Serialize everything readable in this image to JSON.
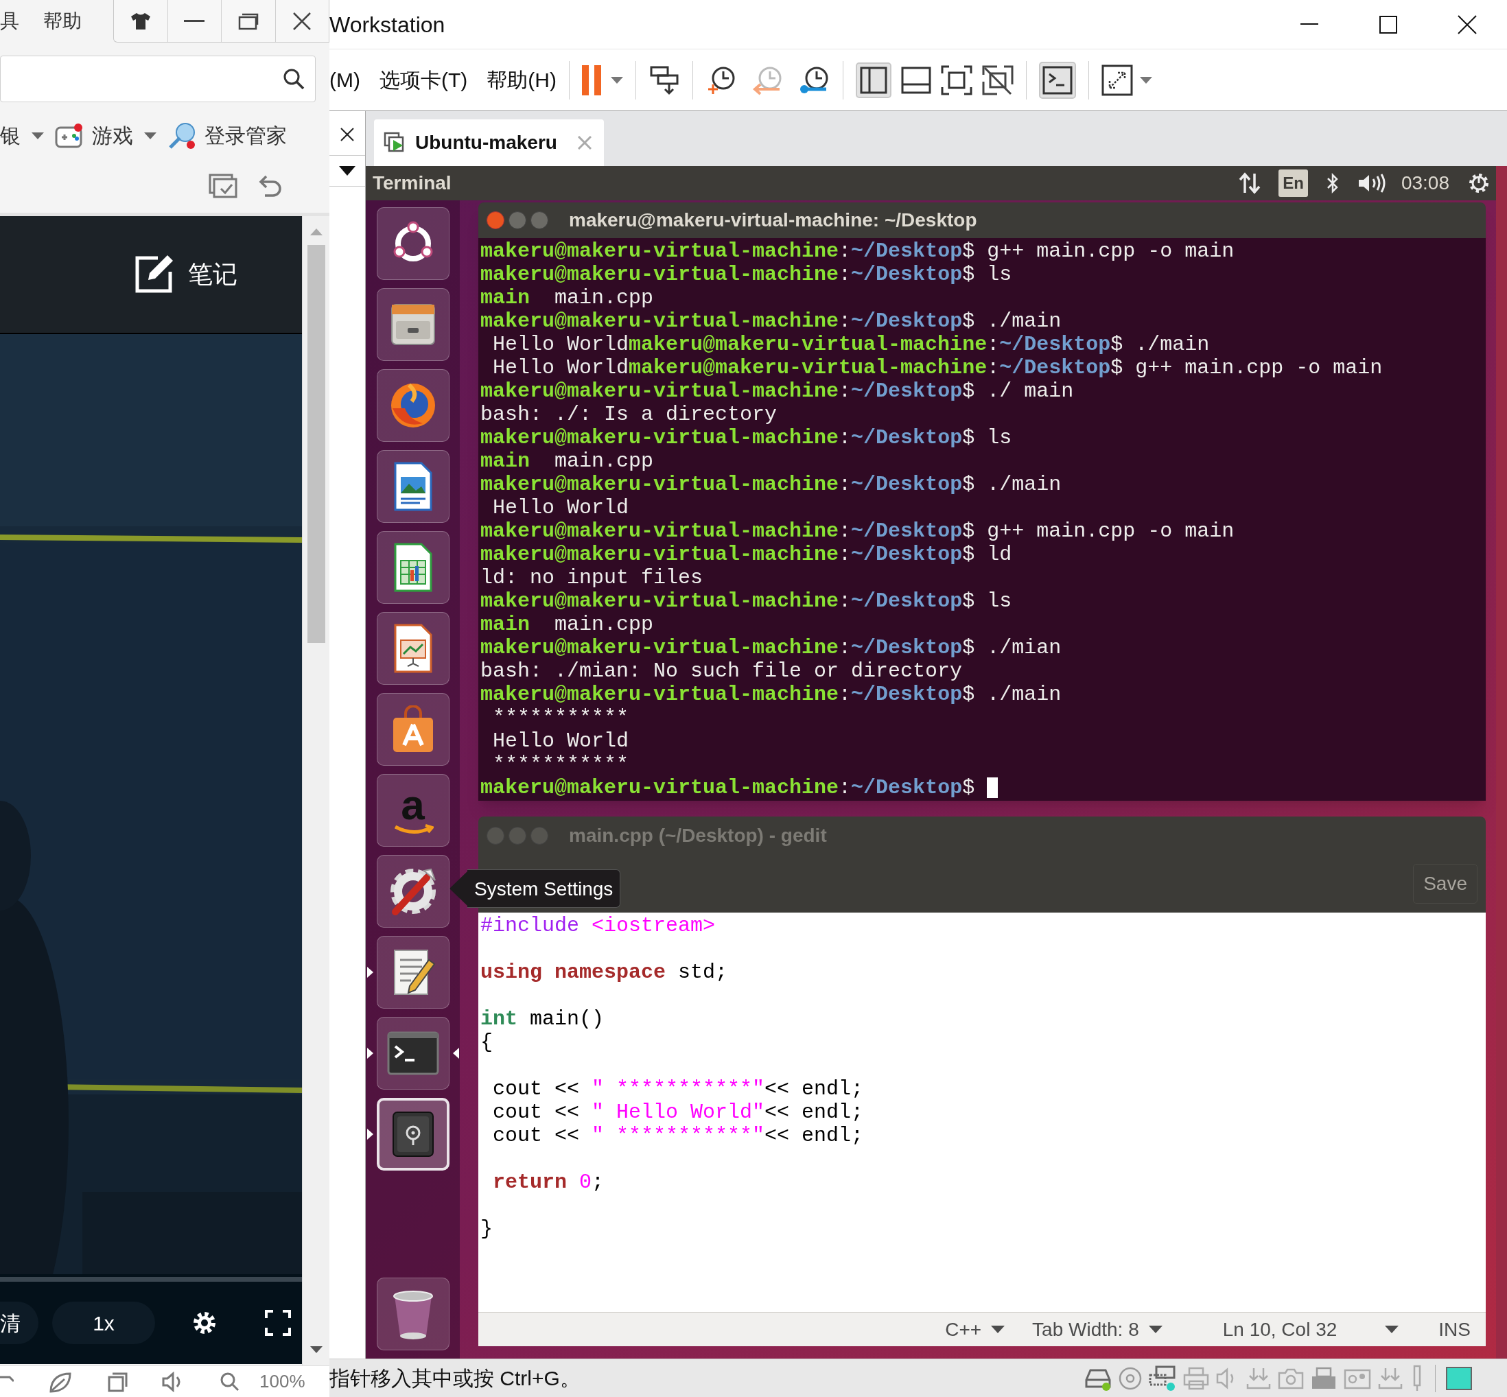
{
  "browser": {
    "menu": [
      "具",
      "帮助"
    ],
    "bookmarks": [
      {
        "label": "银",
        "kind": "bank",
        "dropdown": true
      },
      {
        "label": "游戏",
        "kind": "games",
        "dropdown": true
      },
      {
        "label": "登录管家",
        "kind": "key",
        "dropdown": false
      }
    ],
    "notes": "笔记",
    "player": {
      "quality": "清",
      "speed": "1x"
    },
    "zoom": "100%"
  },
  "vmware": {
    "title": "Workstation",
    "menu": [
      "(M)",
      "选项卡(T)",
      "帮助(H)"
    ],
    "tabs": [
      {
        "label": "Ubuntu-makeru",
        "selected": true
      }
    ],
    "hint": "指针移入其中或按 Ctrl+G。"
  },
  "ubuntu": {
    "panel": {
      "app": "Terminal",
      "keyboard": "En",
      "time": "03:08"
    },
    "launcher": [
      {
        "kind": "dash",
        "running": false,
        "focused": false,
        "selected": false
      },
      {
        "kind": "files",
        "running": false,
        "focused": false,
        "selected": false
      },
      {
        "kind": "firefox",
        "running": false,
        "focused": false,
        "selected": false
      },
      {
        "kind": "writer",
        "running": false,
        "focused": false,
        "selected": false
      },
      {
        "kind": "calc",
        "running": false,
        "focused": false,
        "selected": false
      },
      {
        "kind": "impress",
        "running": false,
        "focused": false,
        "selected": false
      },
      {
        "kind": "software",
        "running": false,
        "focused": false,
        "selected": false
      },
      {
        "kind": "amazon",
        "glyph": "a",
        "running": false,
        "focused": false,
        "selected": false
      },
      {
        "kind": "settings",
        "running": false,
        "focused": false,
        "selected": false
      },
      {
        "kind": "gedit",
        "running": true,
        "focused": false,
        "selected": false
      },
      {
        "kind": "terminal",
        "running": true,
        "focused": true,
        "selected": false
      },
      {
        "kind": "safe",
        "running": true,
        "focused": false,
        "selected": true
      },
      {
        "kind": "trash",
        "running": false,
        "focused": false,
        "selected": false
      }
    ],
    "terminal": {
      "title": "makeru@makeru-virtual-machine: ~/Desktop",
      "cursor": true,
      "lines": [
        [
          {
            "kind": "user",
            "text": "makeru@makeru-virtual-machine"
          },
          {
            "kind": "text",
            "text": ":"
          },
          {
            "kind": "path",
            "text": "~/Desktop"
          },
          {
            "kind": "text",
            "text": "$ g++ main.cpp -o main"
          }
        ],
        [
          {
            "kind": "user",
            "text": "makeru@makeru-virtual-machine"
          },
          {
            "kind": "text",
            "text": ":"
          },
          {
            "kind": "path",
            "text": "~/Desktop"
          },
          {
            "kind": "text",
            "text": "$ ls"
          }
        ],
        [
          {
            "kind": "exec",
            "text": "main"
          },
          {
            "kind": "text",
            "text": "  main.cpp"
          }
        ],
        [
          {
            "kind": "user",
            "text": "makeru@makeru-virtual-machine"
          },
          {
            "kind": "text",
            "text": ":"
          },
          {
            "kind": "path",
            "text": "~/Desktop"
          },
          {
            "kind": "text",
            "text": "$ ./main"
          }
        ],
        [
          {
            "kind": "text",
            "text": " Hello World"
          },
          {
            "kind": "user",
            "text": "makeru@makeru-virtual-machine"
          },
          {
            "kind": "text",
            "text": ":"
          },
          {
            "kind": "path",
            "text": "~/Desktop"
          },
          {
            "kind": "text",
            "text": "$ ./main"
          }
        ],
        [
          {
            "kind": "text",
            "text": " Hello World"
          },
          {
            "kind": "user",
            "text": "makeru@makeru-virtual-machine"
          },
          {
            "kind": "text",
            "text": ":"
          },
          {
            "kind": "path",
            "text": "~/Desktop"
          },
          {
            "kind": "text",
            "text": "$ g++ main.cpp -o main"
          }
        ],
        [
          {
            "kind": "user",
            "text": "makeru@makeru-virtual-machine"
          },
          {
            "kind": "text",
            "text": ":"
          },
          {
            "kind": "path",
            "text": "~/Desktop"
          },
          {
            "kind": "text",
            "text": "$ ./ main"
          }
        ],
        [
          {
            "kind": "text",
            "text": "bash: ./: Is a directory"
          }
        ],
        [
          {
            "kind": "user",
            "text": "makeru@makeru-virtual-machine"
          },
          {
            "kind": "text",
            "text": ":"
          },
          {
            "kind": "path",
            "text": "~/Desktop"
          },
          {
            "kind": "text",
            "text": "$ ls"
          }
        ],
        [
          {
            "kind": "exec",
            "text": "main"
          },
          {
            "kind": "text",
            "text": "  main.cpp"
          }
        ],
        [
          {
            "kind": "user",
            "text": "makeru@makeru-virtual-machine"
          },
          {
            "kind": "text",
            "text": ":"
          },
          {
            "kind": "path",
            "text": "~/Desktop"
          },
          {
            "kind": "text",
            "text": "$ ./main"
          }
        ],
        [
          {
            "kind": "text",
            "text": " Hello World"
          }
        ],
        [
          {
            "kind": "user",
            "text": "makeru@makeru-virtual-machine"
          },
          {
            "kind": "text",
            "text": ":"
          },
          {
            "kind": "path",
            "text": "~/Desktop"
          },
          {
            "kind": "text",
            "text": "$ g++ main.cpp -o main"
          }
        ],
        [
          {
            "kind": "user",
            "text": "makeru@makeru-virtual-machine"
          },
          {
            "kind": "text",
            "text": ":"
          },
          {
            "kind": "path",
            "text": "~/Desktop"
          },
          {
            "kind": "text",
            "text": "$ ld"
          }
        ],
        [
          {
            "kind": "text",
            "text": "ld: no input files"
          }
        ],
        [
          {
            "kind": "user",
            "text": "makeru@makeru-virtual-machine"
          },
          {
            "kind": "text",
            "text": ":"
          },
          {
            "kind": "path",
            "text": "~/Desktop"
          },
          {
            "kind": "text",
            "text": "$ ls"
          }
        ],
        [
          {
            "kind": "exec",
            "text": "main"
          },
          {
            "kind": "text",
            "text": "  main.cpp"
          }
        ],
        [
          {
            "kind": "user",
            "text": "makeru@makeru-virtual-machine"
          },
          {
            "kind": "text",
            "text": ":"
          },
          {
            "kind": "path",
            "text": "~/Desktop"
          },
          {
            "kind": "text",
            "text": "$ ./mian"
          }
        ],
        [
          {
            "kind": "text",
            "text": "bash: ./mian: No such file or directory"
          }
        ],
        [
          {
            "kind": "user",
            "text": "makeru@makeru-virtual-machine"
          },
          {
            "kind": "text",
            "text": ":"
          },
          {
            "kind": "path",
            "text": "~/Desktop"
          },
          {
            "kind": "text",
            "text": "$ ./main"
          }
        ],
        [
          {
            "kind": "text",
            "text": " ***********"
          }
        ],
        [
          {
            "kind": "text",
            "text": " Hello World"
          }
        ],
        [
          {
            "kind": "text",
            "text": " ***********"
          }
        ],
        [
          {
            "kind": "user",
            "text": "makeru@makeru-virtual-machine"
          },
          {
            "kind": "text",
            "text": ":"
          },
          {
            "kind": "path",
            "text": "~/Desktop"
          },
          {
            "kind": "text",
            "text": "$"
          }
        ]
      ]
    },
    "gedit": {
      "title": "main.cpp (~/Desktop) - gedit",
      "active": false,
      "save": "Save",
      "tooltip": "System Settings",
      "lines": [
        {
          "segs": [
            {
              "kind": "preproc",
              "text": "#include "
            },
            {
              "kind": "string",
              "text": "<iostream>"
            }
          ]
        },
        {
          "kind": "blank"
        },
        {
          "segs": [
            {
              "kind": "keyword",
              "text": "using namespace"
            },
            {
              "kind": "text",
              "text": " std;"
            }
          ]
        },
        {
          "kind": "blank"
        },
        {
          "segs": [
            {
              "kind": "type",
              "text": "int"
            },
            {
              "kind": "text",
              "text": " main()"
            }
          ]
        },
        {
          "segs": [
            {
              "kind": "text",
              "text": "{"
            }
          ]
        },
        {
          "kind": "blank"
        },
        {
          "segs": [
            {
              "kind": "text",
              "text": " cout << "
            },
            {
              "kind": "string",
              "text": "\" ***********\""
            },
            {
              "kind": "text",
              "text": "<< endl;"
            }
          ]
        },
        {
          "segs": [
            {
              "kind": "text",
              "text": " cout << "
            },
            {
              "kind": "string",
              "text": "\" Hello World\""
            },
            {
              "kind": "text",
              "text": "<< endl;"
            }
          ]
        },
        {
          "segs": [
            {
              "kind": "text",
              "text": " cout << "
            },
            {
              "kind": "string",
              "text": "\" ***********\""
            },
            {
              "kind": "text",
              "text": "<< endl;"
            }
          ]
        },
        {
          "kind": "blank"
        },
        {
          "segs": [
            {
              "kind": "keyword",
              "text": " return "
            },
            {
              "kind": "number",
              "text": "0"
            },
            {
              "kind": "text",
              "text": ";"
            }
          ]
        },
        {
          "kind": "blank"
        },
        {
          "segs": [
            {
              "kind": "text",
              "text": "}"
            }
          ]
        }
      ],
      "status": {
        "language": "C++",
        "tab_width": "Tab Width: 8",
        "position": "Ln 10, Col 32",
        "mode": "INS"
      }
    }
  }
}
